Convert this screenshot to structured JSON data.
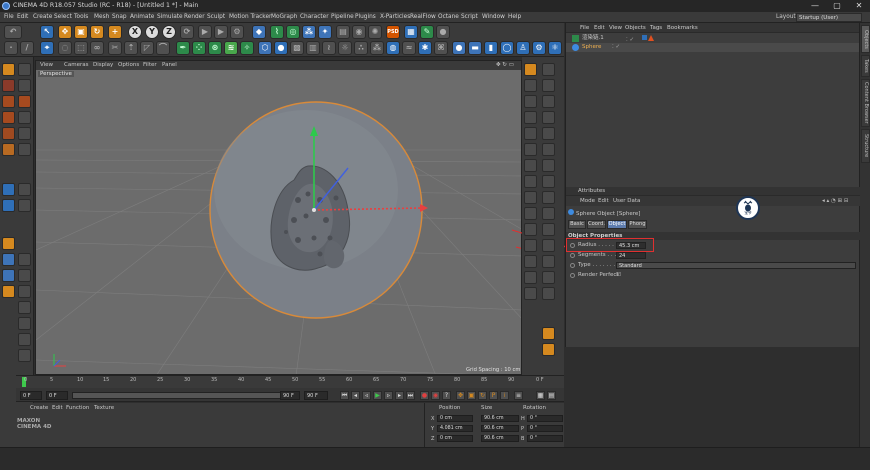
{
  "window": {
    "title": "CINEMA 4D R18.057 Studio (RC - R18) - [Untitled 1 *] - Main",
    "buttons": [
      "—",
      "▢",
      "✕"
    ]
  },
  "menu": [
    "File",
    "Edit",
    "Create",
    "Select",
    "Tools",
    "Mesh",
    "Snap",
    "Animate",
    "Simulate",
    "Render",
    "Sculpt",
    "Motion Tracker",
    "MoGraph",
    "Character",
    "Pipeline",
    "Plugins",
    "X-Particles",
    "RealFlow",
    "Octane",
    "Script",
    "Window",
    "Help"
  ],
  "layout": {
    "label": "Layout:",
    "value": "Startup (User)"
  },
  "toolbar": {
    "axis_labels": [
      "X",
      "Y",
      "Z"
    ],
    "psd_label": "PSD",
    "icons": [
      "undo-icon",
      "select-icon",
      "move-icon",
      "scale-icon",
      "rotate-icon",
      "add-icon",
      "x-lock-icon",
      "y-lock-icon",
      "z-lock-icon",
      "coordinate-icon",
      "render-view-icon",
      "render-icon",
      "render-settings-icon",
      "cube-icon",
      "spline-icon",
      "nurbs-icon",
      "array-icon",
      "deformer-icon",
      "scene-icon",
      "camera-icon",
      "light-icon"
    ]
  },
  "object_manager": {
    "menu": [
      "File",
      "Edit",
      "View",
      "Objects",
      "Tags",
      "Bookmarks"
    ],
    "objects": [
      {
        "name": "渲染链.1",
        "selected": false
      },
      {
        "name": "Sphere",
        "selected": true
      }
    ]
  },
  "side_tabs": [
    "Objects",
    "Takes",
    "Content Browser",
    "Structure"
  ],
  "attributes": {
    "title": "Attributes",
    "menu": [
      "Mode",
      "Edit",
      "User Data"
    ],
    "object_label": "Sphere Object [Sphere]",
    "tabs": [
      "Basic",
      "Coord.",
      "Object",
      "Phong"
    ],
    "active_tab": "Object",
    "section": "Object Properties",
    "props": [
      {
        "name": "Radius . . . . . .",
        "value": "45.3 cm"
      },
      {
        "name": "Segments . . . .",
        "value": "24"
      },
      {
        "name": "Type . . . . . . . .",
        "value": "Standard"
      },
      {
        "name": "Render Perfect",
        "value": "☑"
      }
    ]
  },
  "viewport": {
    "menu": [
      "View",
      "Cameras",
      "Display",
      "Options",
      "Filter",
      "Panel"
    ],
    "label": "Perspective",
    "grid_spacing": "Grid Spacing : 10 cm"
  },
  "timeline": {
    "ticks": [
      "0",
      "5",
      "10",
      "15",
      "20",
      "25",
      "30",
      "35",
      "40",
      "45",
      "50",
      "55",
      "60",
      "65",
      "70",
      "75",
      "80",
      "85",
      "90"
    ],
    "frame_label": "0 F"
  },
  "playback": {
    "start": "0 F",
    "current": "0 F",
    "end": "90 F",
    "end2": "90 F",
    "mid": "0"
  },
  "material_manager": {
    "menu": [
      "Create",
      "Edit",
      "Function",
      "Texture"
    ]
  },
  "coordinates": {
    "headers": [
      "Position",
      "Size",
      "Rotation"
    ],
    "rows": [
      {
        "axis": "X",
        "pos": "0 cm",
        "size": "90.6 cm",
        "rot_axis": "H",
        "rot": "0 °"
      },
      {
        "axis": "Y",
        "pos": "4.081 cm",
        "size": "90.6 cm",
        "rot_axis": "P",
        "rot": "0 °"
      },
      {
        "axis": "Z",
        "pos": "0 cm",
        "size": "90.6 cm",
        "rot_axis": "B",
        "rot": "0 °"
      }
    ],
    "mode": "Object (Rel)",
    "size_mode": "Size",
    "apply": "Apply"
  },
  "brand": {
    "line1": "MAXON",
    "line2": "CINEMA 4D"
  },
  "badge": {
    "text": "宝爷"
  }
}
